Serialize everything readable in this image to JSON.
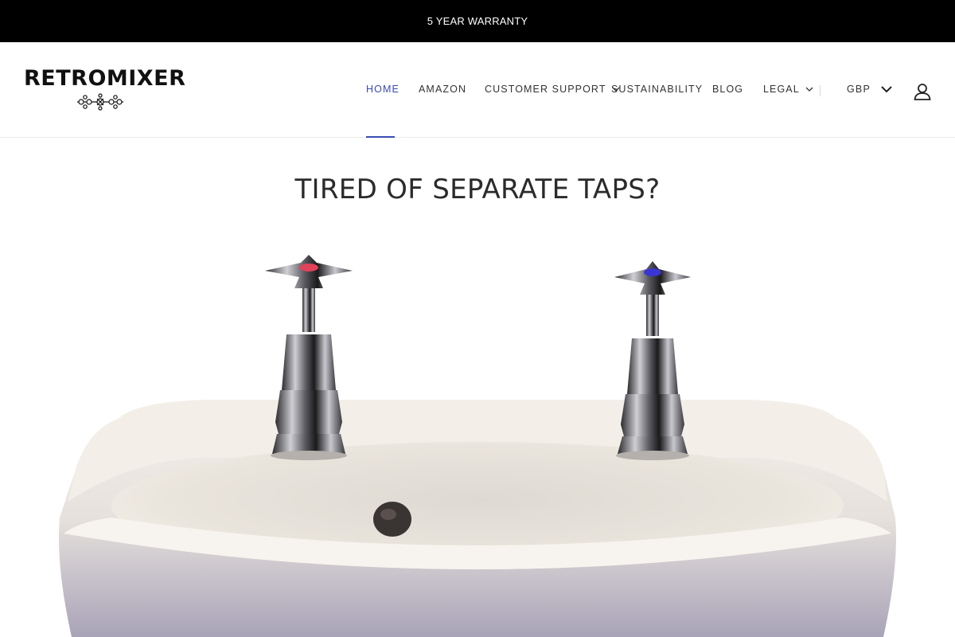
{
  "announcement": {
    "text": "5 YEAR WARRANTY"
  },
  "brand": {
    "name": "RETROMIXER",
    "ornament_icon": "ornament-icon"
  },
  "nav": {
    "items": [
      {
        "label": "HOME",
        "active": true
      },
      {
        "label": "AMAZON"
      },
      {
        "label": "CUSTOMER SUPPORT",
        "has_dropdown": true
      },
      {
        "label": "SUSTAINABILITY"
      },
      {
        "label": "BLOG"
      },
      {
        "label": "LEGAL",
        "has_dropdown": true
      }
    ],
    "accent_color": "#3a4bb3"
  },
  "currency": {
    "value": "GBP",
    "icon": "chevron-down-icon"
  },
  "account": {
    "icon": "user-icon"
  },
  "hero": {
    "title": "TIRED OF SEPARATE TAPS?",
    "image": "photo of a white washbasin with separate hot and cold chrome cross-head taps",
    "hot_tap_color": "#e0425a",
    "cold_tap_color": "#3a35d0"
  }
}
